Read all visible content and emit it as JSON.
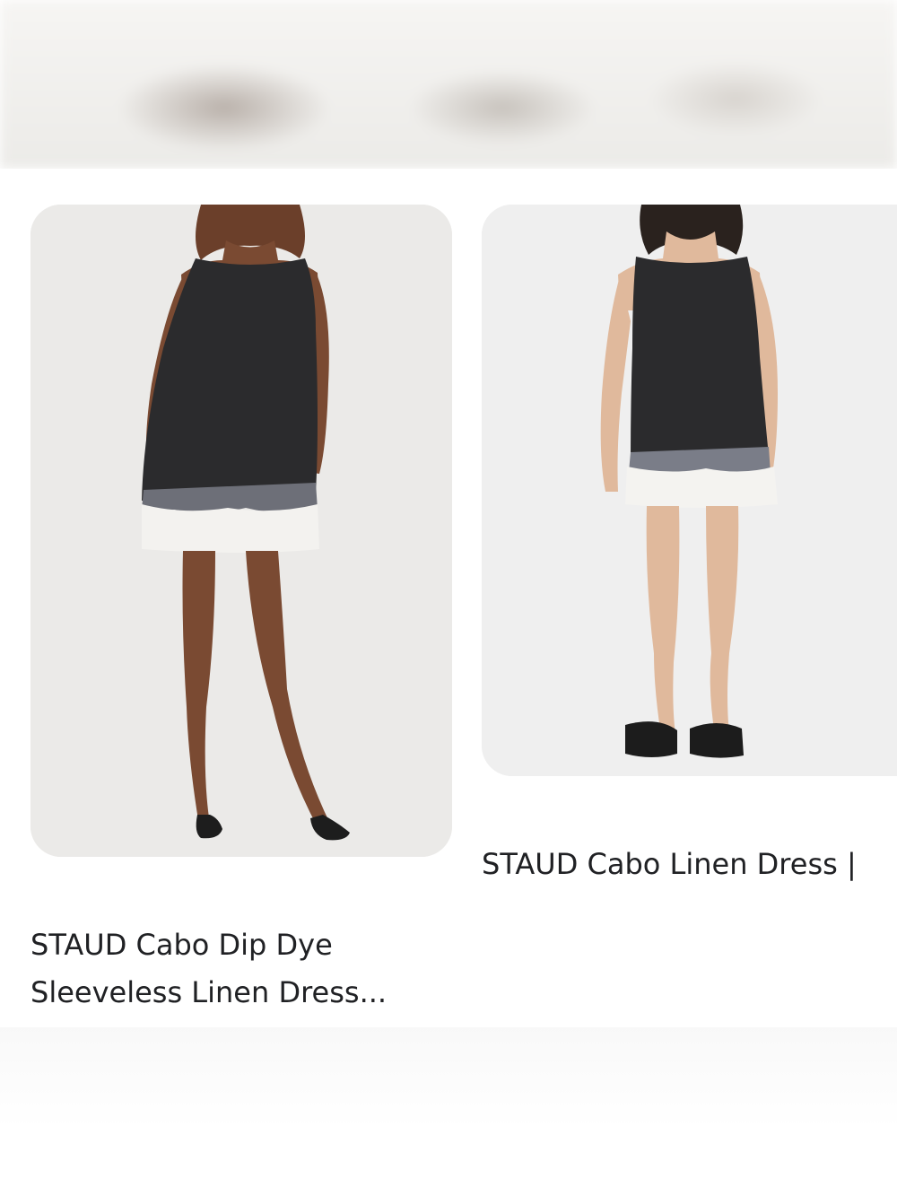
{
  "results": [
    {
      "title_line1": "STAUD Cabo Dip Dye",
      "title_line2": "Sleeveless Linen Dress...",
      "image_icon": "product-photo-dress"
    },
    {
      "title_line1": "STAUD Cabo Linen Dress |",
      "image_icon": "product-photo-dress"
    }
  ],
  "colors": {
    "text": "#202124",
    "card_background": "#ebeae8",
    "dress_dark": "#2b2b2d",
    "dress_hem": "#f1f0ed"
  }
}
